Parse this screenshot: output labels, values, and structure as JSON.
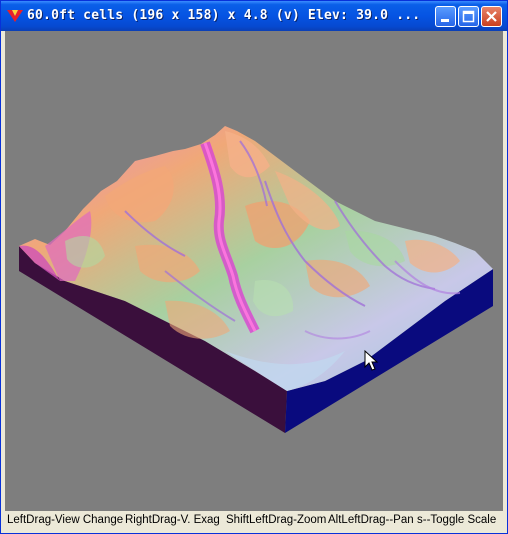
{
  "window": {
    "title": "60.0ft cells (196 x 158) x 4.8 (v)  Elev: 39.0 ...",
    "buttons": {
      "minimize": "minimize-icon",
      "maximize": "maximize-icon",
      "close": "close-icon"
    }
  },
  "status_bar": {
    "items": [
      "LeftDrag-View Change",
      "RightDrag-V. Exag",
      "ShiftLeftDrag-Zoom",
      "AltLeftDrag--Pan",
      "s--Toggle Scale"
    ]
  },
  "colors": {
    "viewport_bg": "#7e7e7e",
    "block_side_left": "#3a0f3c",
    "block_side_right": "#090a7e",
    "terrain_peak": "#f0a878",
    "terrain_valley": "#e866c0",
    "terrain_mid": "#a8d0a0",
    "terrain_low": "#b0c8e8"
  }
}
